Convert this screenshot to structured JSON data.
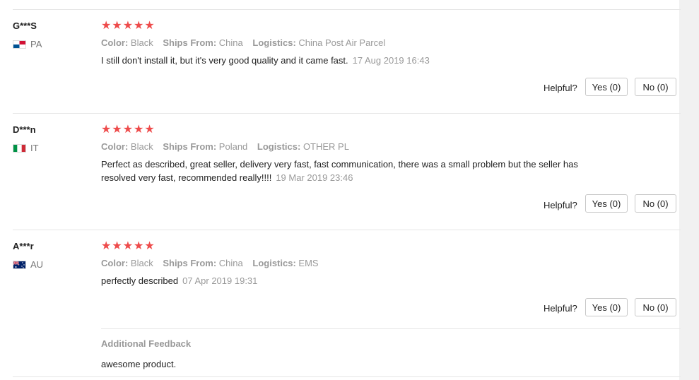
{
  "reviews": [
    {
      "user": "G***S",
      "country": "PA",
      "stars": "★★★★★",
      "color_label": "Color:",
      "color": "Black",
      "ships_label": "Ships From:",
      "ships": "China",
      "logistics_label": "Logistics:",
      "logistics": "China Post Air Parcel",
      "text": "I still don't install it, but it's very good quality and it came fast.",
      "date": "17 Aug 2019 16:43",
      "helpful_label": "Helpful?",
      "yes_label": "Yes (0)",
      "no_label": "No (0)"
    },
    {
      "user": "D***n",
      "country": "IT",
      "stars": "★★★★★",
      "color_label": "Color:",
      "color": "Black",
      "ships_label": "Ships From:",
      "ships": "Poland",
      "logistics_label": "Logistics:",
      "logistics": "OTHER PL",
      "text": "Perfect as described, great seller, delivery very fast, fast communication, there was a small problem but the seller has resolved very fast, recommended really!!!!",
      "date": "19 Mar 2019 23:46",
      "helpful_label": "Helpful?",
      "yes_label": "Yes (0)",
      "no_label": "No (0)"
    },
    {
      "user": "A***r",
      "country": "AU",
      "stars": "★★★★★",
      "color_label": "Color:",
      "color": "Black",
      "ships_label": "Ships From:",
      "ships": "China",
      "logistics_label": "Logistics:",
      "logistics": "EMS",
      "text": "perfectly described",
      "date": "07 Apr 2019 19:31",
      "helpful_label": "Helpful?",
      "yes_label": "Yes (0)",
      "no_label": "No (0)",
      "additional_title": "Additional Feedback",
      "additional_text": "awesome product."
    }
  ],
  "colors": {
    "star": "#ee4b4b",
    "muted": "#999999",
    "divider": "#e6e6e6"
  }
}
